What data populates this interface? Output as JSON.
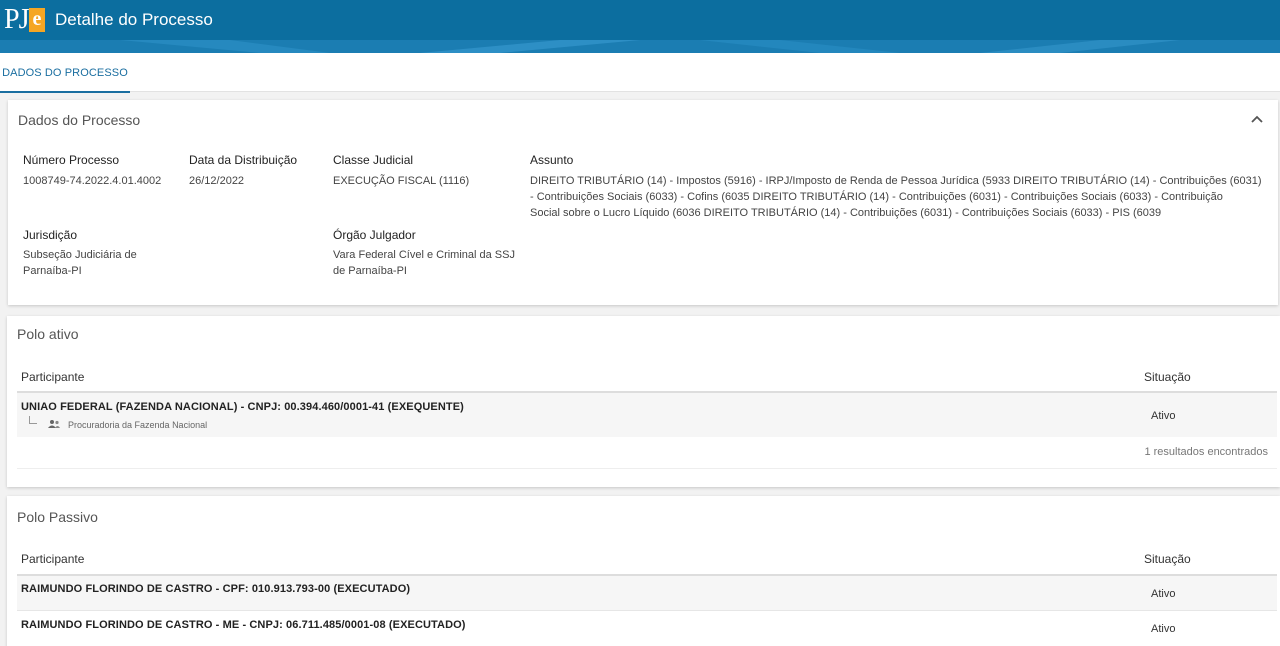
{
  "header": {
    "logo_text": "PJ",
    "logo_accent": "e",
    "title": "Detalhe do Processo",
    "color": "#0c6e9f"
  },
  "tabs": [
    {
      "label": "DADOS DO PROCESSO",
      "active": true
    }
  ],
  "dados": {
    "title": "Dados do Processo",
    "fields": {
      "numero": {
        "label": "Número Processo",
        "value": "1008749-74.2022.4.01.4002"
      },
      "data": {
        "label": "Data da Distribuição",
        "value": "26/12/2022"
      },
      "classe": {
        "label": "Classe Judicial",
        "value": "EXECUÇÃO FISCAL (1116)"
      },
      "assunto": {
        "label": "Assunto",
        "lines": [
          "DIREITO TRIBUTÁRIO (14) - Impostos (5916) - IRPJ/Imposto de Renda de Pessoa Jurídica (5933 DIREITO TRIBUTÁRIO (14) - Contribuições (6031)",
          "- Contribuições Sociais (6033) - Cofins (6035 DIREITO TRIBUTÁRIO (14) - Contribuições (6031) - Contribuições Sociais (6033) - Contribuição",
          "Social sobre o Lucro Líquido (6036 DIREITO TRIBUTÁRIO (14) - Contribuições (6031) - Contribuições Sociais (6033) - PIS (6039"
        ]
      },
      "jurisdicao": {
        "label": "Jurisdição",
        "lines": [
          "Subseção Judiciária de",
          "Parnaíba-PI"
        ]
      },
      "orgao": {
        "label": "Órgão Julgador",
        "lines": [
          "Vara Federal Cível e Criminal da SSJ",
          "de Parnaíba-PI"
        ]
      }
    }
  },
  "polo_ativo": {
    "title": "Polo ativo",
    "col_participante": "Participante",
    "col_situacao": "Situação",
    "rows": [
      {
        "name": "UNIAO FEDERAL (FAZENDA NACIONAL) - CNPJ: 00.394.460/0001-41 (EXEQUENTE)",
        "sub": "Procuradoria da Fazenda Nacional",
        "status": "Ativo"
      }
    ],
    "results": "1 resultados encontrados"
  },
  "polo_passivo": {
    "title": "Polo Passivo",
    "col_participante": "Participante",
    "col_situacao": "Situação",
    "rows": [
      {
        "name": "RAIMUNDO FLORINDO DE CASTRO - CPF: 010.913.793-00 (EXECUTADO)",
        "status": "Ativo"
      },
      {
        "name": "RAIMUNDO FLORINDO DE CASTRO - ME - CNPJ: 06.711.485/0001-08 (EXECUTADO)",
        "status": "Ativo"
      }
    ]
  }
}
